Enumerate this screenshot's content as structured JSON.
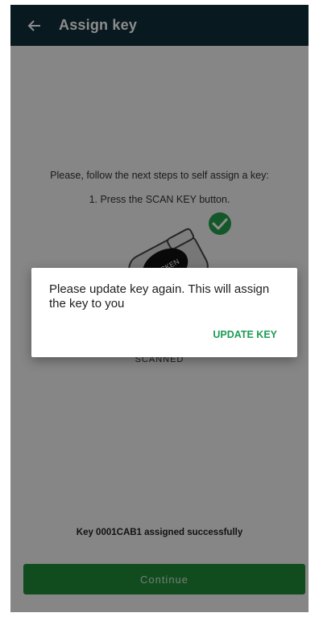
{
  "app_bar": {
    "title": "Assign key",
    "back_icon": "arrow-left-icon"
  },
  "instructions": {
    "line1": "Please, follow the next steps to self assign a key:",
    "line2": "1. Press the SCAN KEY button."
  },
  "illustration": {
    "key_brand": "LOCKEN",
    "status_icon": "checkmark-circle-icon",
    "status_color": "#25a04b"
  },
  "scan_status": "SCANNED",
  "success_message": "Key 0001CAB1 assigned successfully",
  "continue_button": {
    "label": "Continue",
    "color": "#1f8a3a"
  },
  "dialog": {
    "message": "Please update key again. This will assign the key to you",
    "action_label": "UPDATE KEY",
    "action_color": "#1c9c55"
  }
}
